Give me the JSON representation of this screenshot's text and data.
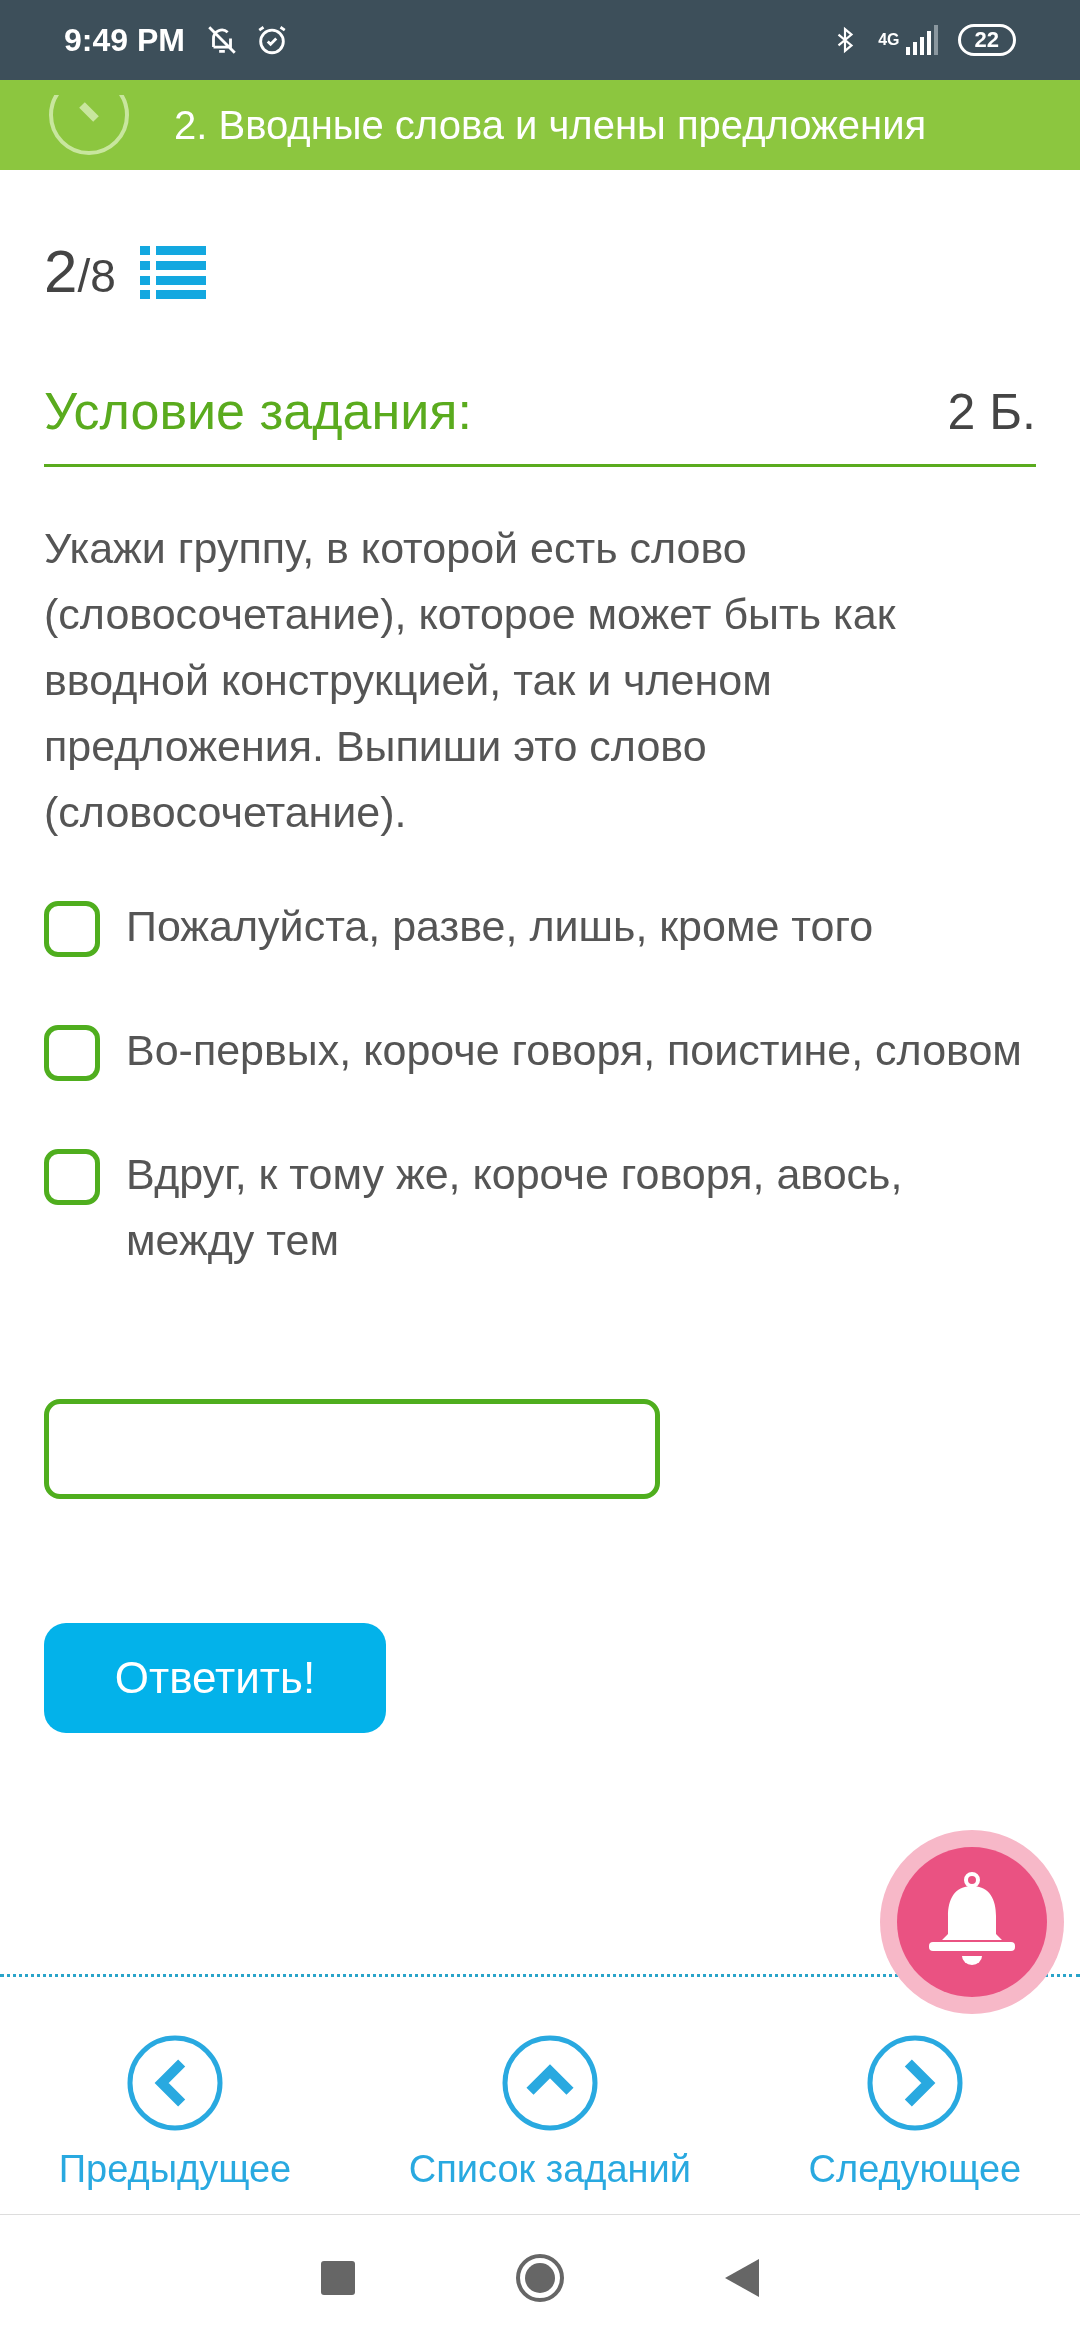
{
  "status_bar": {
    "time": "9:49 PM",
    "network": "4G",
    "battery": "22"
  },
  "header": {
    "title": "2. Вводные слова и члены предложения"
  },
  "progress": {
    "current": "2",
    "total": "/8"
  },
  "task": {
    "heading": "Условие задания:",
    "points": "2 Б.",
    "text": "Укажи группу, в которой есть слово (словосочетание), которое может быть как вводной конструкцией, так и членом предложения. Выпиши это слово (словосочетание)."
  },
  "options": [
    {
      "label": "Пожалуйста, разве, лишь, кроме того",
      "checked": false
    },
    {
      "label": "Во-первых, короче говоря, поистине, словом",
      "checked": false
    },
    {
      "label": "Вдруг, к тому же, короче говоря, авось, между тем",
      "checked": false
    }
  ],
  "answer_button": "Ответить!",
  "nav": [
    {
      "label": "Предыдущее",
      "kind": "prev"
    },
    {
      "label": "Список заданий",
      "kind": "list"
    },
    {
      "label": "Следующее",
      "kind": "next"
    }
  ]
}
